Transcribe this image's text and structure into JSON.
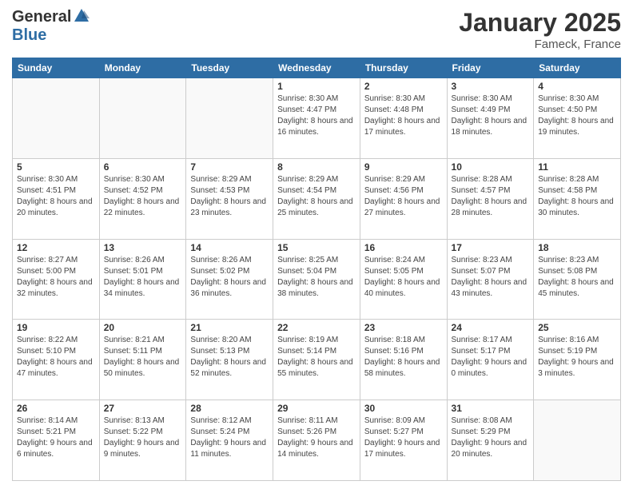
{
  "logo": {
    "general": "General",
    "blue": "Blue"
  },
  "header": {
    "title": "January 2025",
    "location": "Fameck, France"
  },
  "weekdays": [
    "Sunday",
    "Monday",
    "Tuesday",
    "Wednesday",
    "Thursday",
    "Friday",
    "Saturday"
  ],
  "weeks": [
    [
      {
        "day": "",
        "info": ""
      },
      {
        "day": "",
        "info": ""
      },
      {
        "day": "",
        "info": ""
      },
      {
        "day": "1",
        "info": "Sunrise: 8:30 AM\nSunset: 4:47 PM\nDaylight: 8 hours\nand 16 minutes."
      },
      {
        "day": "2",
        "info": "Sunrise: 8:30 AM\nSunset: 4:48 PM\nDaylight: 8 hours\nand 17 minutes."
      },
      {
        "day": "3",
        "info": "Sunrise: 8:30 AM\nSunset: 4:49 PM\nDaylight: 8 hours\nand 18 minutes."
      },
      {
        "day": "4",
        "info": "Sunrise: 8:30 AM\nSunset: 4:50 PM\nDaylight: 8 hours\nand 19 minutes."
      }
    ],
    [
      {
        "day": "5",
        "info": "Sunrise: 8:30 AM\nSunset: 4:51 PM\nDaylight: 8 hours\nand 20 minutes."
      },
      {
        "day": "6",
        "info": "Sunrise: 8:30 AM\nSunset: 4:52 PM\nDaylight: 8 hours\nand 22 minutes."
      },
      {
        "day": "7",
        "info": "Sunrise: 8:29 AM\nSunset: 4:53 PM\nDaylight: 8 hours\nand 23 minutes."
      },
      {
        "day": "8",
        "info": "Sunrise: 8:29 AM\nSunset: 4:54 PM\nDaylight: 8 hours\nand 25 minutes."
      },
      {
        "day": "9",
        "info": "Sunrise: 8:29 AM\nSunset: 4:56 PM\nDaylight: 8 hours\nand 27 minutes."
      },
      {
        "day": "10",
        "info": "Sunrise: 8:28 AM\nSunset: 4:57 PM\nDaylight: 8 hours\nand 28 minutes."
      },
      {
        "day": "11",
        "info": "Sunrise: 8:28 AM\nSunset: 4:58 PM\nDaylight: 8 hours\nand 30 minutes."
      }
    ],
    [
      {
        "day": "12",
        "info": "Sunrise: 8:27 AM\nSunset: 5:00 PM\nDaylight: 8 hours\nand 32 minutes."
      },
      {
        "day": "13",
        "info": "Sunrise: 8:26 AM\nSunset: 5:01 PM\nDaylight: 8 hours\nand 34 minutes."
      },
      {
        "day": "14",
        "info": "Sunrise: 8:26 AM\nSunset: 5:02 PM\nDaylight: 8 hours\nand 36 minutes."
      },
      {
        "day": "15",
        "info": "Sunrise: 8:25 AM\nSunset: 5:04 PM\nDaylight: 8 hours\nand 38 minutes."
      },
      {
        "day": "16",
        "info": "Sunrise: 8:24 AM\nSunset: 5:05 PM\nDaylight: 8 hours\nand 40 minutes."
      },
      {
        "day": "17",
        "info": "Sunrise: 8:23 AM\nSunset: 5:07 PM\nDaylight: 8 hours\nand 43 minutes."
      },
      {
        "day": "18",
        "info": "Sunrise: 8:23 AM\nSunset: 5:08 PM\nDaylight: 8 hours\nand 45 minutes."
      }
    ],
    [
      {
        "day": "19",
        "info": "Sunrise: 8:22 AM\nSunset: 5:10 PM\nDaylight: 8 hours\nand 47 minutes."
      },
      {
        "day": "20",
        "info": "Sunrise: 8:21 AM\nSunset: 5:11 PM\nDaylight: 8 hours\nand 50 minutes."
      },
      {
        "day": "21",
        "info": "Sunrise: 8:20 AM\nSunset: 5:13 PM\nDaylight: 8 hours\nand 52 minutes."
      },
      {
        "day": "22",
        "info": "Sunrise: 8:19 AM\nSunset: 5:14 PM\nDaylight: 8 hours\nand 55 minutes."
      },
      {
        "day": "23",
        "info": "Sunrise: 8:18 AM\nSunset: 5:16 PM\nDaylight: 8 hours\nand 58 minutes."
      },
      {
        "day": "24",
        "info": "Sunrise: 8:17 AM\nSunset: 5:17 PM\nDaylight: 9 hours\nand 0 minutes."
      },
      {
        "day": "25",
        "info": "Sunrise: 8:16 AM\nSunset: 5:19 PM\nDaylight: 9 hours\nand 3 minutes."
      }
    ],
    [
      {
        "day": "26",
        "info": "Sunrise: 8:14 AM\nSunset: 5:21 PM\nDaylight: 9 hours\nand 6 minutes."
      },
      {
        "day": "27",
        "info": "Sunrise: 8:13 AM\nSunset: 5:22 PM\nDaylight: 9 hours\nand 9 minutes."
      },
      {
        "day": "28",
        "info": "Sunrise: 8:12 AM\nSunset: 5:24 PM\nDaylight: 9 hours\nand 11 minutes."
      },
      {
        "day": "29",
        "info": "Sunrise: 8:11 AM\nSunset: 5:26 PM\nDaylight: 9 hours\nand 14 minutes."
      },
      {
        "day": "30",
        "info": "Sunrise: 8:09 AM\nSunset: 5:27 PM\nDaylight: 9 hours\nand 17 minutes."
      },
      {
        "day": "31",
        "info": "Sunrise: 8:08 AM\nSunset: 5:29 PM\nDaylight: 9 hours\nand 20 minutes."
      },
      {
        "day": "",
        "info": ""
      }
    ]
  ]
}
